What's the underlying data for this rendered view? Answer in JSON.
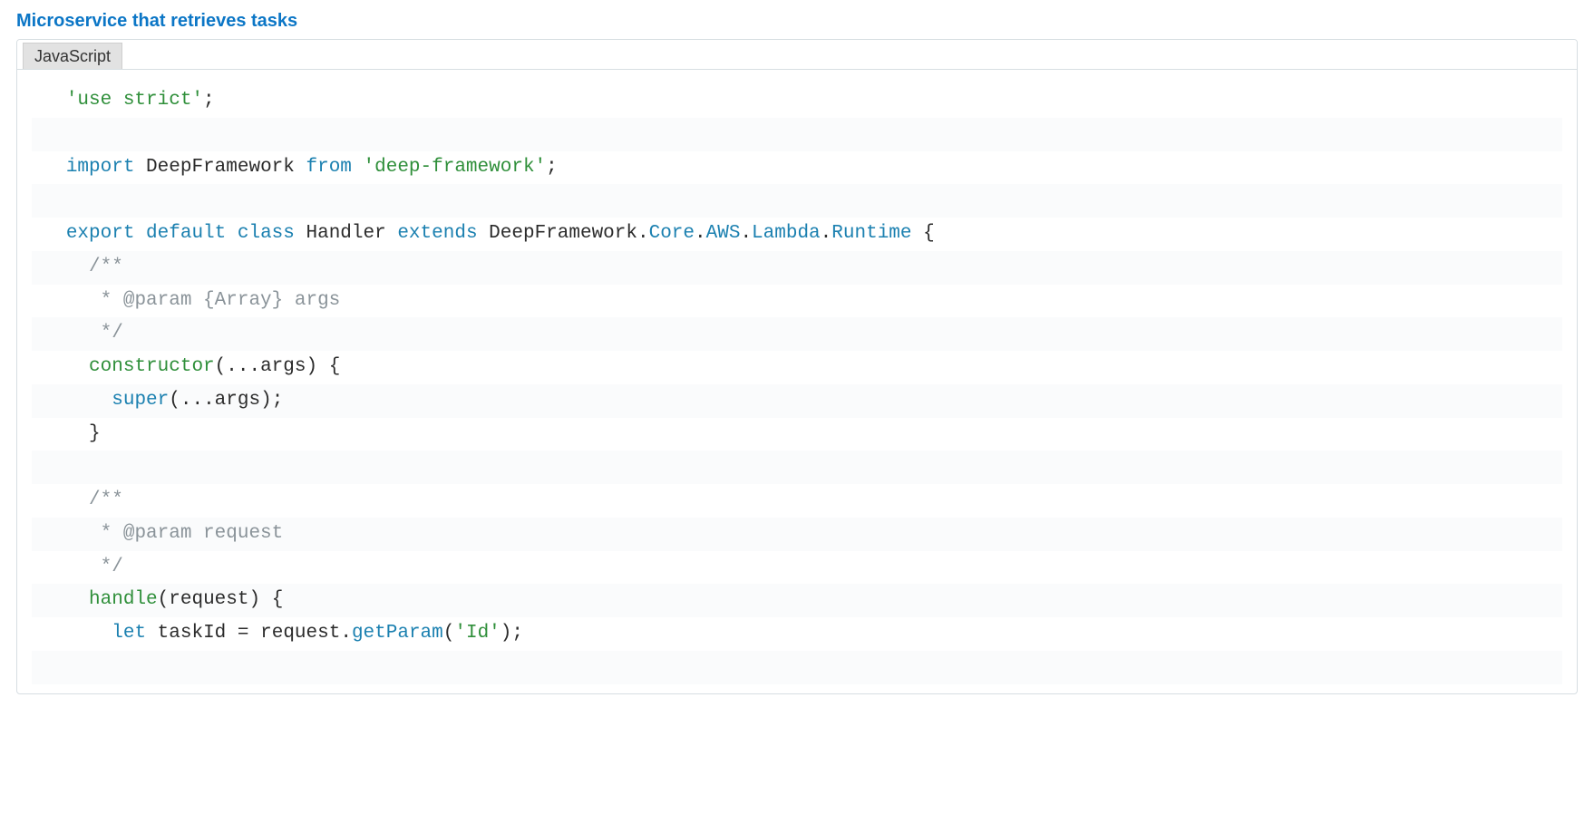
{
  "title": "Microservice that retrieves tasks",
  "tab_label": "JavaScript",
  "code": {
    "lines": [
      {
        "tokens": [
          {
            "cls": "tok-string",
            "text": "'use strict'"
          },
          {
            "cls": "tok-semi",
            "text": ";"
          }
        ]
      },
      {
        "tokens": [
          {
            "cls": "",
            "text": " "
          }
        ]
      },
      {
        "tokens": [
          {
            "cls": "tok-keyword-import",
            "text": "import"
          },
          {
            "cls": "",
            "text": " "
          },
          {
            "cls": "tok-ident",
            "text": "DeepFramework"
          },
          {
            "cls": "",
            "text": " "
          },
          {
            "cls": "tok-keyword-from",
            "text": "from"
          },
          {
            "cls": "",
            "text": " "
          },
          {
            "cls": "tok-string",
            "text": "'deep-framework'"
          },
          {
            "cls": "tok-semi",
            "text": ";"
          }
        ]
      },
      {
        "tokens": [
          {
            "cls": "",
            "text": " "
          }
        ]
      },
      {
        "tokens": [
          {
            "cls": "tok-keyword-export",
            "text": "export"
          },
          {
            "cls": "",
            "text": " "
          },
          {
            "cls": "tok-keyword-default",
            "text": "default"
          },
          {
            "cls": "",
            "text": " "
          },
          {
            "cls": "tok-keyword-class",
            "text": "class"
          },
          {
            "cls": "",
            "text": " "
          },
          {
            "cls": "tok-classname",
            "text": "Handler"
          },
          {
            "cls": "",
            "text": " "
          },
          {
            "cls": "tok-keyword-extends",
            "text": "extends"
          },
          {
            "cls": "",
            "text": " "
          },
          {
            "cls": "tok-ident",
            "text": "DeepFramework"
          },
          {
            "cls": "tok-punct",
            "text": "."
          },
          {
            "cls": "tok-member",
            "text": "Core"
          },
          {
            "cls": "tok-punct",
            "text": "."
          },
          {
            "cls": "tok-member",
            "text": "AWS"
          },
          {
            "cls": "tok-punct",
            "text": "."
          },
          {
            "cls": "tok-member",
            "text": "Lambda"
          },
          {
            "cls": "tok-punct",
            "text": "."
          },
          {
            "cls": "tok-member",
            "text": "Runtime"
          },
          {
            "cls": "",
            "text": " "
          },
          {
            "cls": "tok-brace",
            "text": "{"
          }
        ]
      },
      {
        "tokens": [
          {
            "cls": "",
            "text": "  "
          },
          {
            "cls": "tok-comment",
            "text": "/**"
          }
        ]
      },
      {
        "tokens": [
          {
            "cls": "",
            "text": "  "
          },
          {
            "cls": "tok-comment",
            "text": " * @param {Array} args"
          }
        ]
      },
      {
        "tokens": [
          {
            "cls": "",
            "text": "  "
          },
          {
            "cls": "tok-comment",
            "text": " */"
          }
        ]
      },
      {
        "tokens": [
          {
            "cls": "",
            "text": "  "
          },
          {
            "cls": "tok-method",
            "text": "constructor"
          },
          {
            "cls": "tok-paren",
            "text": "("
          },
          {
            "cls": "tok-punct",
            "text": "..."
          },
          {
            "cls": "tok-ident",
            "text": "args"
          },
          {
            "cls": "tok-paren",
            "text": ")"
          },
          {
            "cls": "",
            "text": " "
          },
          {
            "cls": "tok-brace",
            "text": "{"
          }
        ]
      },
      {
        "tokens": [
          {
            "cls": "",
            "text": "    "
          },
          {
            "cls": "tok-keyword-super",
            "text": "super"
          },
          {
            "cls": "tok-paren",
            "text": "("
          },
          {
            "cls": "tok-punct",
            "text": "..."
          },
          {
            "cls": "tok-ident",
            "text": "args"
          },
          {
            "cls": "tok-paren",
            "text": ")"
          },
          {
            "cls": "tok-semi",
            "text": ";"
          }
        ]
      },
      {
        "tokens": [
          {
            "cls": "",
            "text": "  "
          },
          {
            "cls": "tok-brace",
            "text": "}"
          }
        ]
      },
      {
        "tokens": [
          {
            "cls": "",
            "text": " "
          }
        ]
      },
      {
        "tokens": [
          {
            "cls": "",
            "text": "  "
          },
          {
            "cls": "tok-comment",
            "text": "/**"
          }
        ]
      },
      {
        "tokens": [
          {
            "cls": "",
            "text": "  "
          },
          {
            "cls": "tok-comment",
            "text": " * @param request"
          }
        ]
      },
      {
        "tokens": [
          {
            "cls": "",
            "text": "  "
          },
          {
            "cls": "tok-comment",
            "text": " */"
          }
        ]
      },
      {
        "tokens": [
          {
            "cls": "",
            "text": "  "
          },
          {
            "cls": "tok-method",
            "text": "handle"
          },
          {
            "cls": "tok-paren",
            "text": "("
          },
          {
            "cls": "tok-ident",
            "text": "request"
          },
          {
            "cls": "tok-paren",
            "text": ")"
          },
          {
            "cls": "",
            "text": " "
          },
          {
            "cls": "tok-brace",
            "text": "{"
          }
        ]
      },
      {
        "tokens": [
          {
            "cls": "",
            "text": "    "
          },
          {
            "cls": "tok-keyword-let",
            "text": "let"
          },
          {
            "cls": "",
            "text": " "
          },
          {
            "cls": "tok-ident",
            "text": "taskId"
          },
          {
            "cls": "",
            "text": " "
          },
          {
            "cls": "tok-punct",
            "text": "="
          },
          {
            "cls": "",
            "text": " "
          },
          {
            "cls": "tok-ident",
            "text": "request"
          },
          {
            "cls": "tok-punct",
            "text": "."
          },
          {
            "cls": "tok-call",
            "text": "getParam"
          },
          {
            "cls": "tok-paren",
            "text": "("
          },
          {
            "cls": "tok-string",
            "text": "'Id'"
          },
          {
            "cls": "tok-paren",
            "text": ")"
          },
          {
            "cls": "tok-semi",
            "text": ";"
          }
        ]
      },
      {
        "tokens": [
          {
            "cls": "",
            "text": " "
          }
        ]
      }
    ]
  }
}
